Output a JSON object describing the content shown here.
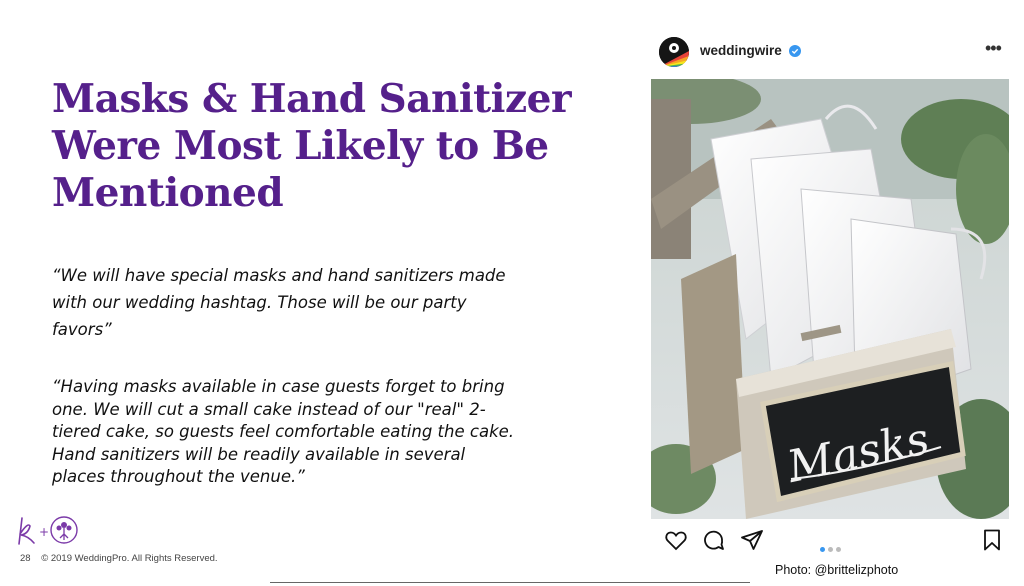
{
  "slide": {
    "title": "Masks & Hand Sanitizer Were Most Likely to Be Mentioned",
    "quotes": [
      "“We will have special masks and hand sanitizers made with our wedding hashtag. Those will be our party favors”",
      "“Having masks available in case guests forget to bring one. We will cut a small cake instead of our \"real\" 2-tiered cake, so guests feel comfortable eating the cake. Hand sanitizers will be readily available in several places throughout the venue.”"
    ],
    "page_number": "28",
    "copyright": "© 2019 WeddingPro. All Rights Reserved.",
    "photo_credit": "Photo: @brittelizphoto"
  },
  "post": {
    "username": "weddingwire",
    "more_icon": "more-horizontal-icon",
    "verified_icon": "verified-badge-icon",
    "sign_text": "Masks",
    "carousel": {
      "total": 3,
      "active": 1
    },
    "icons": [
      "heart-icon",
      "comment-icon",
      "share-icon",
      "bookmark-icon"
    ]
  },
  "colors": {
    "title": "#55208b",
    "text": "#111111",
    "accent": "#3897f0"
  }
}
